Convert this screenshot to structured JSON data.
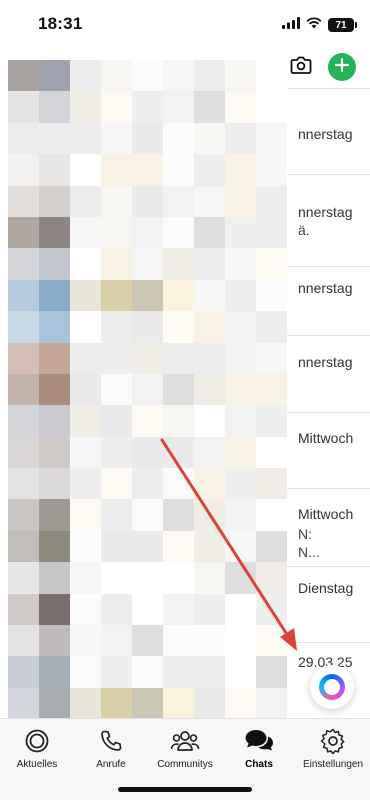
{
  "status_bar": {
    "time": "18:31",
    "battery": "71",
    "icons": [
      "signal-icon",
      "wifi-icon",
      "battery-icon"
    ]
  },
  "header": {
    "icons": [
      "camera-icon",
      "plus-icon"
    ],
    "accent": "#25b35a"
  },
  "chat_list": {
    "dates": [
      "nnerstag",
      "nnerstag",
      "nnerstag",
      "nnerstag",
      "Mittwoch",
      "Mittwoch",
      "Dienstag",
      "29.03.25"
    ],
    "subtexts": [
      "ä.",
      "N:",
      "N..."
    ]
  },
  "tabs": [
    {
      "label": "Aktuelles",
      "icon": "updates-icon"
    },
    {
      "label": "Anrufe",
      "icon": "phone-icon"
    },
    {
      "label": "Communitys",
      "icon": "communities-icon"
    },
    {
      "label": "Chats",
      "icon": "chats-icon"
    },
    {
      "label": "Einstellungen",
      "icon": "gear-icon"
    }
  ],
  "active_tab": "Chats",
  "colors": {
    "annotation_arrow": "#e0403a",
    "tab_bar_bg": "#f7f7f7"
  }
}
